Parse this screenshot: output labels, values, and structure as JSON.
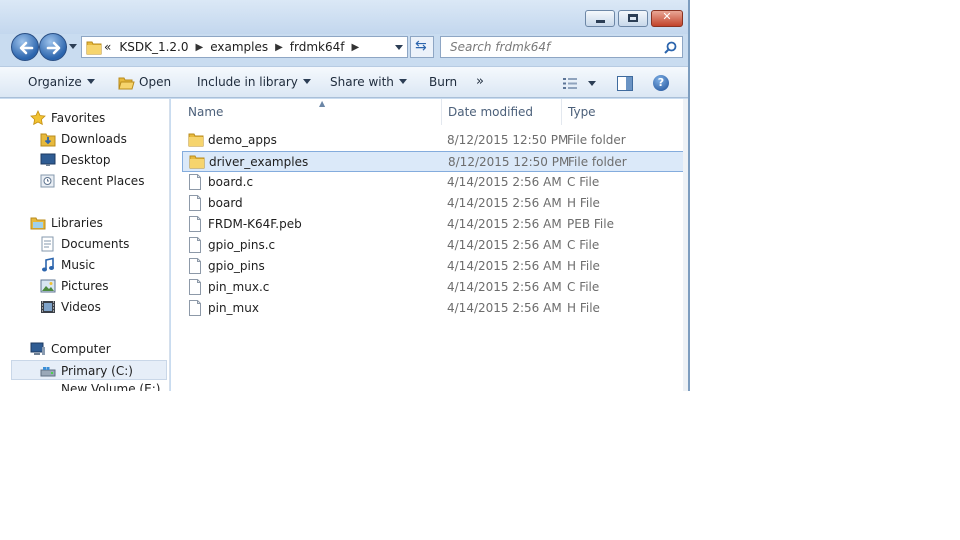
{
  "window": {
    "controls": {
      "minimize": "minimize",
      "maximize": "maximize",
      "close": "✕"
    }
  },
  "address": {
    "overflow": "«",
    "crumbs": [
      "KSDK_1.2.0",
      "examples",
      "frdmk64f"
    ]
  },
  "search": {
    "placeholder": "Search frdmk64f"
  },
  "toolbar": {
    "organize": "Organize",
    "open": "Open",
    "include_in_library": "Include in library",
    "share_with": "Share with",
    "burn": "Burn",
    "more": "»",
    "help": "?"
  },
  "navpane": {
    "favorites": {
      "label": "Favorites",
      "items": [
        "Downloads",
        "Desktop",
        "Recent Places"
      ]
    },
    "libraries": {
      "label": "Libraries",
      "items": [
        "Documents",
        "Music",
        "Pictures",
        "Videos"
      ]
    },
    "computer": {
      "label": "Computer",
      "items": [
        "Primary (C:)",
        "New Volume (E:)"
      ]
    }
  },
  "columns": {
    "name": "Name",
    "date": "Date modified",
    "type": "Type"
  },
  "files": [
    {
      "name": "demo_apps",
      "date": "8/12/2015 12:50 PM",
      "type": "File folder",
      "icon": "folder-icon",
      "selected": false
    },
    {
      "name": "driver_examples",
      "date": "8/12/2015 12:50 PM",
      "type": "File folder",
      "icon": "folder-icon",
      "selected": true
    },
    {
      "name": "board.c",
      "date": "4/14/2015 2:56 AM",
      "type": "C File",
      "icon": "file-icon",
      "selected": false
    },
    {
      "name": "board",
      "date": "4/14/2015 2:56 AM",
      "type": "H File",
      "icon": "file-icon",
      "selected": false
    },
    {
      "name": "FRDM-K64F.peb",
      "date": "4/14/2015 2:56 AM",
      "type": "PEB File",
      "icon": "file-icon",
      "selected": false
    },
    {
      "name": "gpio_pins.c",
      "date": "4/14/2015 2:56 AM",
      "type": "C File",
      "icon": "file-icon",
      "selected": false
    },
    {
      "name": "gpio_pins",
      "date": "4/14/2015 2:56 AM",
      "type": "H File",
      "icon": "file-icon",
      "selected": false
    },
    {
      "name": "pin_mux.c",
      "date": "4/14/2015 2:56 AM",
      "type": "C File",
      "icon": "file-icon",
      "selected": false
    },
    {
      "name": "pin_mux",
      "date": "4/14/2015 2:56 AM",
      "type": "H File",
      "icon": "file-icon",
      "selected": false
    }
  ]
}
